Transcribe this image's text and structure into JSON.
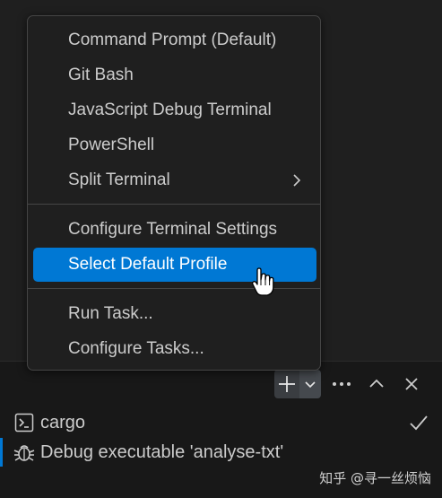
{
  "menu": {
    "items": [
      {
        "label": "Command Prompt (Default)"
      },
      {
        "label": "Git Bash"
      },
      {
        "label": "JavaScript Debug Terminal"
      },
      {
        "label": "PowerShell"
      },
      {
        "label": "Split Terminal"
      },
      {
        "label": "Configure Terminal Settings"
      },
      {
        "label": "Select Default Profile"
      },
      {
        "label": "Run Task..."
      },
      {
        "label": "Configure Tasks..."
      }
    ],
    "selected_label": "Select Default Profile"
  },
  "toolbar": {
    "new_terminal_icon": "plus-icon",
    "profiles_dropdown_icon": "chevron-down-icon",
    "more_icon": "ellipsis-icon",
    "maximize_icon": "chevron-up-icon",
    "close_icon": "close-icon"
  },
  "terminals": [
    {
      "label": "cargo",
      "icon": "terminal-icon",
      "status_icon": "check-icon"
    },
    {
      "label": "Debug executable 'analyse-txt'",
      "icon": "debug-icon",
      "active": true
    }
  ],
  "watermark": "知乎 @寻一丝烦恼",
  "colors": {
    "accent": "#0078d4",
    "menu_bg": "#1f1f1f",
    "panel_bg": "#181818",
    "text": "#cccccc"
  }
}
